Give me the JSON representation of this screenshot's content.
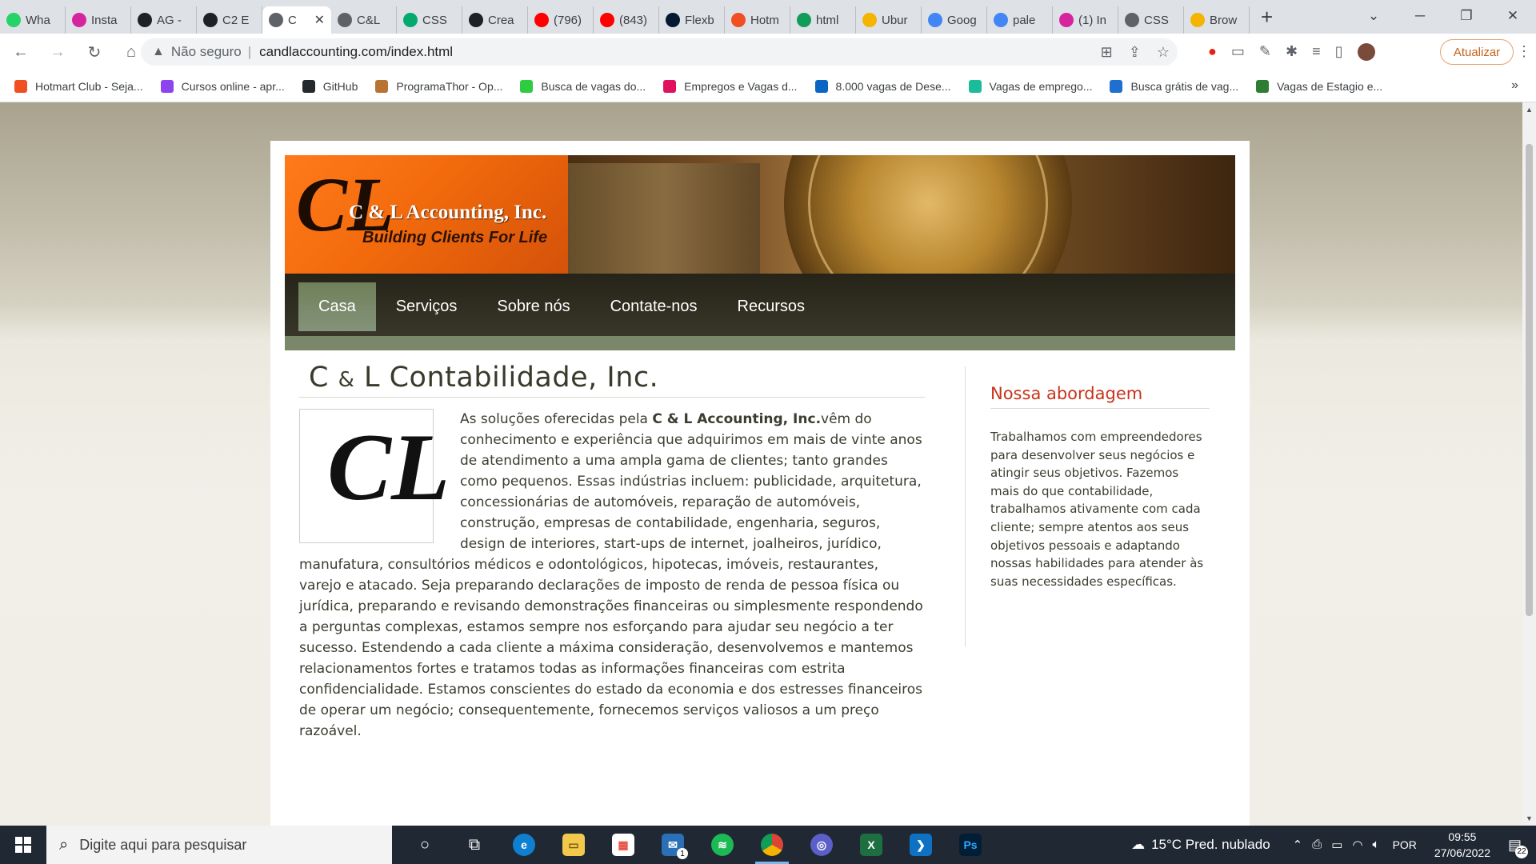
{
  "browser": {
    "tabs": [
      {
        "label": "Wha",
        "icon": "whatsapp-icon",
        "color": "#25d366"
      },
      {
        "label": "Insta",
        "icon": "instagram-icon",
        "color": "#d6249f"
      },
      {
        "label": "AG -",
        "icon": "codepen-icon",
        "color": "#202124"
      },
      {
        "label": "C2 E",
        "icon": "codepen-icon",
        "color": "#202124"
      },
      {
        "label": "C",
        "icon": "globe-icon",
        "color": "#5f6368",
        "active": true
      },
      {
        "label": "C&L",
        "icon": "globe-icon",
        "color": "#5f6368"
      },
      {
        "label": "CSS",
        "icon": "w3schools-icon",
        "color": "#04aa6d"
      },
      {
        "label": "Crea",
        "icon": "codepen-icon",
        "color": "#202124"
      },
      {
        "label": "(796)",
        "icon": "youtube-icon",
        "color": "#ff0000"
      },
      {
        "label": "(843)",
        "icon": "youtube-icon",
        "color": "#ff0000"
      },
      {
        "label": "Flexb",
        "icon": "alura-icon",
        "color": "#051933"
      },
      {
        "label": "Hotm",
        "icon": "hotmart-icon",
        "color": "#f04e23"
      },
      {
        "label": "html",
        "icon": "sheet-icon",
        "color": "#0f9d58"
      },
      {
        "label": "Ubur",
        "icon": "blocks-icon",
        "color": "#f4b400"
      },
      {
        "label": "Goog",
        "icon": "translate-icon",
        "color": "#4285f4"
      },
      {
        "label": "pale",
        "icon": "google-icon",
        "color": "#4285f4"
      },
      {
        "label": "(1) In",
        "icon": "instagram-icon",
        "color": "#d6249f"
      },
      {
        "label": "CSS",
        "icon": "globe-icon",
        "color": "#5f6368"
      },
      {
        "label": "Brow",
        "icon": "blocks-icon",
        "color": "#f4b400"
      }
    ],
    "address": {
      "security_label": "Não seguro",
      "url": "candlaccounting.com/index.html"
    },
    "update_label": "Atualizar",
    "bookmarks": [
      {
        "label": "Hotmart Club - Seja...",
        "color": "#f04e23"
      },
      {
        "label": "Cursos online - apr...",
        "color": "#8e44ec"
      },
      {
        "label": "GitHub",
        "color": "#24292e"
      },
      {
        "label": "ProgramaThor - Op...",
        "color": "#b87333"
      },
      {
        "label": "Busca de vagas do...",
        "color": "#2ecc40"
      },
      {
        "label": "Empregos e Vagas d...",
        "color": "#e0115f"
      },
      {
        "label": "8.000 vagas de Dese...",
        "color": "#0a66c2"
      },
      {
        "label": "Vagas de emprego...",
        "color": "#1abc9c"
      },
      {
        "label": "Busca grátis de vag...",
        "color": "#1f6fd1"
      },
      {
        "label": "Vagas de Estagio e...",
        "color": "#2e7d32"
      }
    ]
  },
  "site": {
    "logo": {
      "mark": "CL",
      "company": "C & L Accounting, Inc.",
      "tagline": "Building Clients For Life"
    },
    "nav": [
      {
        "label": "Casa",
        "active": true
      },
      {
        "label": "Serviços"
      },
      {
        "label": "Sobre nós"
      },
      {
        "label": "Contate-nos"
      },
      {
        "label": "Recursos"
      }
    ],
    "main": {
      "title_pre": "C ",
      "title_amp": "&",
      "title_post": " L Contabilidade, Inc.",
      "box_mark": "CL",
      "text_before": "As soluções oferecidas pela ",
      "text_strong": "C & L Accounting, Inc.",
      "text_after": "vêm do conhecimento e experiência que adquirimos em mais de vinte anos de atendimento a uma ampla gama de clientes; tanto grandes como pequenos. Essas indústrias incluem: publicidade, arquitetura, concessionárias de automóveis, reparação de automóveis, construção, empresas de contabilidade, engenharia, seguros, design de interiores, start-ups de internet, joalheiros, jurídico, manufatura, consultórios médicos e odontológicos, hipotecas, imóveis, restaurantes, varejo e atacado. Seja preparando declarações de imposto de renda de pessoa física ou jurídica, preparando e revisando demonstrações financeiras ou simplesmente respondendo a perguntas complexas, estamos sempre nos esforçando para ajudar seu negócio a ter sucesso. Estendendo a cada cliente a máxima consideração, desenvolvemos e mantemos relacionamentos fortes e tratamos todas as informações financeiras com estrita confidencialidade. Estamos conscientes do estado da economia e dos estresses financeiros de operar um negócio; consequentemente, fornecemos serviços valiosos a um preço razoável."
    },
    "sidebar": {
      "title": "Nossa abordagem",
      "text": "Trabalhamos com empreendedores para desenvolver seus negócios e atingir seus objetivos. Fazemos mais do que contabilidade, trabalhamos ativamente com cada cliente; sempre atentos aos seus objetivos pessoais e adaptando nossas habilidades para atender às suas necessidades específicas."
    }
  },
  "taskbar": {
    "search_placeholder": "Digite aqui para pesquisar",
    "weather": "15°C  Pred. nublado",
    "lang": "POR",
    "time": "09:55",
    "date": "27/06/2022",
    "notifications": "22",
    "mail_badge": "1"
  }
}
